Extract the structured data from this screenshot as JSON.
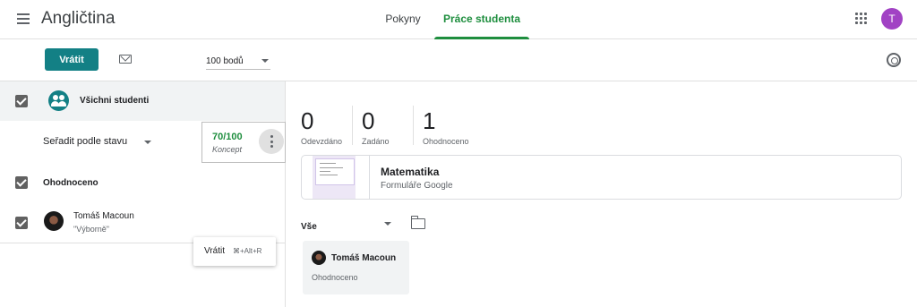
{
  "app": {
    "title": "Angličtina",
    "account_initial": "T"
  },
  "tabs": [
    {
      "label": "Pokyny",
      "active": false
    },
    {
      "label": "Práce studenta",
      "active": true
    }
  ],
  "toolbar": {
    "return_label": "Vrátit",
    "points_value": "100 bodů"
  },
  "left": {
    "all_students_label": "Všichni studenti",
    "sort_label": "Seřadit podle stavu",
    "graded_group_label": "Ohodnoceno",
    "student": {
      "name": "Tomáš Macoun",
      "comment": "\"Výborně\"",
      "score": "70/100",
      "status": "Koncept"
    },
    "menu": {
      "item_label": "Vrátit",
      "item_shortcut": "⌘+Alt+R"
    }
  },
  "stats": [
    {
      "value": "0",
      "label": "Odevzdáno"
    },
    {
      "value": "0",
      "label": "Zadáno"
    },
    {
      "value": "1",
      "label": "Ohodnoceno"
    }
  ],
  "assignment": {
    "title": "Matematika",
    "subtitle": "Formuláře Google"
  },
  "filter": {
    "value": "Vše"
  },
  "student_card": {
    "name": "Tomáš Macoun",
    "status": "Ohodnoceno"
  },
  "icons": {
    "menu": "hamburger-icon",
    "apps": "apps-grid-icon",
    "mail": "mail-icon",
    "settings": "gear-icon",
    "group": "group-icon",
    "more": "more-vert-icon",
    "folder": "folder-icon",
    "dropdown": "chevron-down-icon"
  },
  "colors": {
    "accent": "#1e8e3e",
    "teal": "#138085",
    "avatar": "#a142c4"
  }
}
